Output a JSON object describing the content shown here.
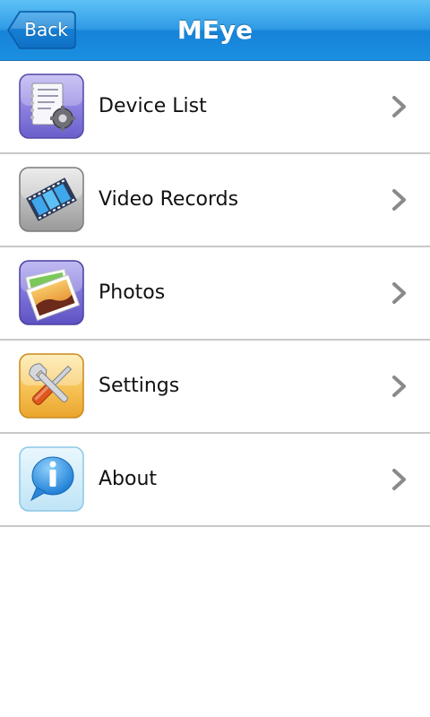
{
  "header": {
    "back_label": "Back",
    "title": "MEye"
  },
  "menu": {
    "items": [
      {
        "label": "Device List",
        "icon": "device-list-icon"
      },
      {
        "label": "Video Records",
        "icon": "film-strip-icon"
      },
      {
        "label": "Photos",
        "icon": "photos-icon"
      },
      {
        "label": "Settings",
        "icon": "wrench-screwdriver-icon"
      },
      {
        "label": "About",
        "icon": "info-bubble-icon"
      }
    ]
  },
  "colors": {
    "header_top": "#5ec2f6",
    "header_bottom": "#1683d8",
    "divider": "#c8c8c8",
    "chevron": "#8a8a8a"
  }
}
